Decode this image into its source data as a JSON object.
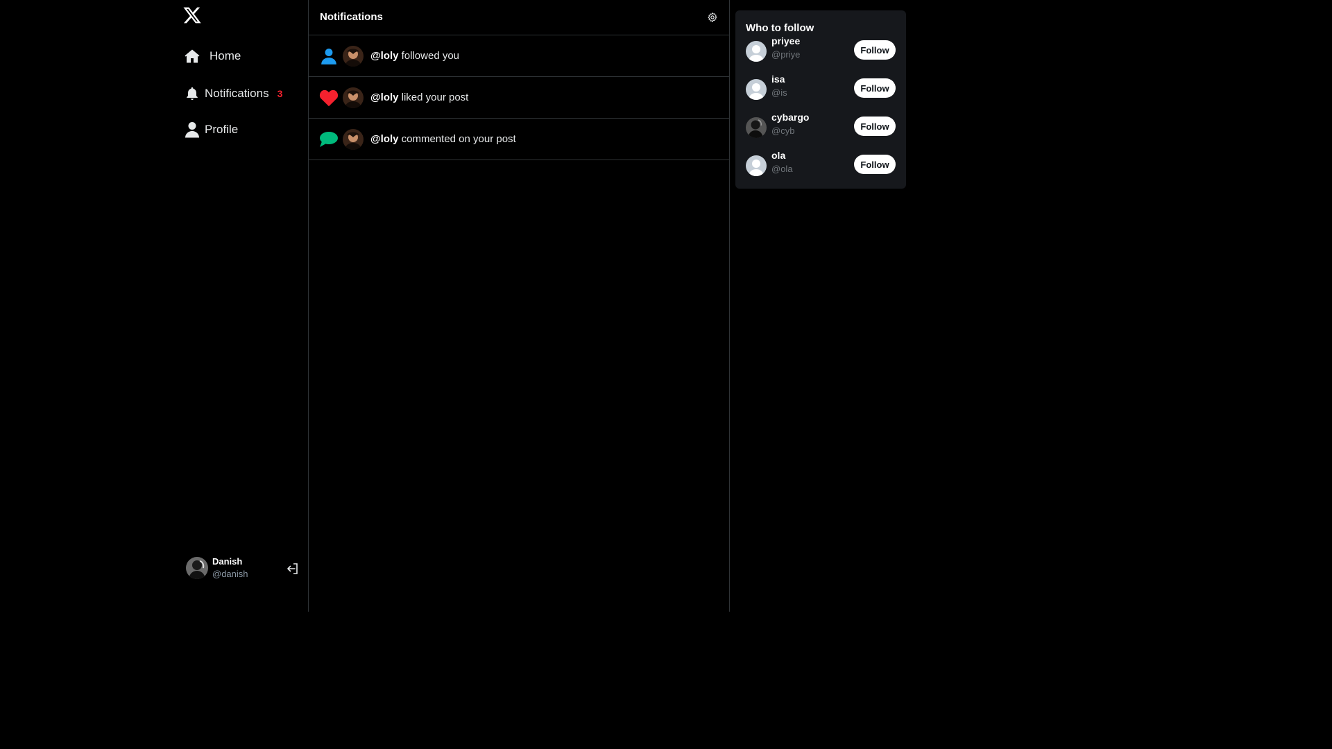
{
  "sidebar": {
    "logo": "x-logo-icon",
    "nav": [
      {
        "label": "Home",
        "icon": "home-icon"
      },
      {
        "label": "Notifications",
        "icon": "bell-icon",
        "badge": "3"
      },
      {
        "label": "Profile",
        "icon": "user-icon"
      }
    ],
    "user": {
      "name": "Danish",
      "handle": "@danish"
    },
    "logout_icon": "logout-icon"
  },
  "main": {
    "title": "Notifications",
    "settings_icon": "gear-icon",
    "notifications": [
      {
        "type": "follow",
        "icon": "person-icon",
        "handle": "@loly",
        "text": " followed you",
        "icon_color": "#1d9bf0"
      },
      {
        "type": "like",
        "icon": "heart-icon",
        "handle": "@loly",
        "text": " liked your post",
        "icon_color": "#f4212e"
      },
      {
        "type": "comment",
        "icon": "speech-bubble-icon",
        "handle": "@loly",
        "text": " commented on your post",
        "icon_color": "#00ba7c"
      }
    ]
  },
  "who_to_follow": {
    "title": "Who to follow",
    "users": [
      {
        "name": "priyee",
        "handle": "@priye",
        "button": "Follow"
      },
      {
        "name": "isa",
        "handle": "@is",
        "button": "Follow"
      },
      {
        "name": "cybargo",
        "handle": "@cyb",
        "button": "Follow"
      },
      {
        "name": "ola",
        "handle": "@ola",
        "button": "Follow"
      }
    ]
  },
  "colors": {
    "background": "#000000",
    "border": "#2f3336",
    "badge": "#f4212e",
    "card": "#16181c"
  }
}
